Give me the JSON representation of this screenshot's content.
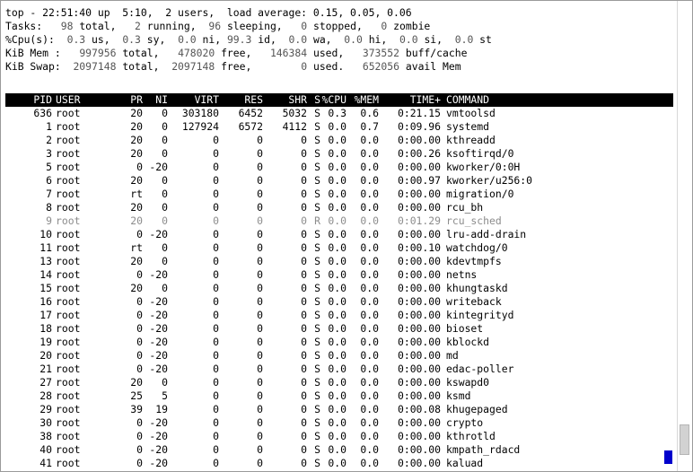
{
  "summary": {
    "line1": "top - 22:51:40 up  5:10,  2 users,  load average: 0.15, 0.05, 0.06",
    "tasks": {
      "label": "Tasks:",
      "total": "98",
      "total_label": "total,",
      "running": "2",
      "running_label": "running,",
      "sleeping": "96",
      "sleeping_label": "sleeping,",
      "stopped": "0",
      "stopped_label": "stopped,",
      "zombie": "0",
      "zombie_label": "zombie"
    },
    "cpu": {
      "label": "%Cpu(s):",
      "us": "0.3",
      "us_label": "us,",
      "sy": "0.3",
      "sy_label": "sy,",
      "ni": "0.0",
      "ni_label": "ni,",
      "id": "99.3",
      "id_label": "id,",
      "wa": "0.0",
      "wa_label": "wa,",
      "hi": "0.0",
      "hi_label": "hi,",
      "si": "0.0",
      "si_label": "si,",
      "st": "0.0",
      "st_label": "st"
    },
    "mem": {
      "label": "KiB Mem :",
      "total": "997956",
      "total_label": "total,",
      "free": "478020",
      "free_label": "free,",
      "used": "146384",
      "used_label": "used,",
      "buff": "373552",
      "buff_label": "buff/cache"
    },
    "swap": {
      "label": "KiB Swap:",
      "total": "2097148",
      "total_label": "total,",
      "free": "2097148",
      "free_label": "free,",
      "used": "0",
      "used_label": "used.",
      "avail": "652056",
      "avail_label": "avail Mem"
    }
  },
  "columns": [
    "PID",
    "USER",
    "PR",
    "NI",
    "VIRT",
    "RES",
    "SHR",
    "S",
    "%CPU",
    "%MEM",
    "TIME+",
    "COMMAND"
  ],
  "processes": [
    [
      "636",
      "root",
      "20",
      "0",
      "303180",
      "6452",
      "5032",
      "S",
      "0.3",
      "0.6",
      "0:21.15",
      "vmtoolsd"
    ],
    [
      "1",
      "root",
      "20",
      "0",
      "127924",
      "6572",
      "4112",
      "S",
      "0.0",
      "0.7",
      "0:09.96",
      "systemd"
    ],
    [
      "2",
      "root",
      "20",
      "0",
      "0",
      "0",
      "0",
      "S",
      "0.0",
      "0.0",
      "0:00.00",
      "kthreadd"
    ],
    [
      "3",
      "root",
      "20",
      "0",
      "0",
      "0",
      "0",
      "S",
      "0.0",
      "0.0",
      "0:00.26",
      "ksoftirqd/0"
    ],
    [
      "5",
      "root",
      "0",
      "-20",
      "0",
      "0",
      "0",
      "S",
      "0.0",
      "0.0",
      "0:00.00",
      "kworker/0:0H"
    ],
    [
      "6",
      "root",
      "20",
      "0",
      "0",
      "0",
      "0",
      "S",
      "0.0",
      "0.0",
      "0:00.97",
      "kworker/u256:0"
    ],
    [
      "7",
      "root",
      "rt",
      "0",
      "0",
      "0",
      "0",
      "S",
      "0.0",
      "0.0",
      "0:00.00",
      "migration/0"
    ],
    [
      "8",
      "root",
      "20",
      "0",
      "0",
      "0",
      "0",
      "S",
      "0.0",
      "0.0",
      "0:00.00",
      "rcu_bh"
    ],
    [
      "9",
      "root",
      "20",
      "0",
      "0",
      "0",
      "0",
      "R",
      "0.0",
      "0.0",
      "0:01.29",
      "rcu_sched"
    ],
    [
      "10",
      "root",
      "0",
      "-20",
      "0",
      "0",
      "0",
      "S",
      "0.0",
      "0.0",
      "0:00.00",
      "lru-add-drain"
    ],
    [
      "11",
      "root",
      "rt",
      "0",
      "0",
      "0",
      "0",
      "S",
      "0.0",
      "0.0",
      "0:00.10",
      "watchdog/0"
    ],
    [
      "13",
      "root",
      "20",
      "0",
      "0",
      "0",
      "0",
      "S",
      "0.0",
      "0.0",
      "0:00.00",
      "kdevtmpfs"
    ],
    [
      "14",
      "root",
      "0",
      "-20",
      "0",
      "0",
      "0",
      "S",
      "0.0",
      "0.0",
      "0:00.00",
      "netns"
    ],
    [
      "15",
      "root",
      "20",
      "0",
      "0",
      "0",
      "0",
      "S",
      "0.0",
      "0.0",
      "0:00.00",
      "khungtaskd"
    ],
    [
      "16",
      "root",
      "0",
      "-20",
      "0",
      "0",
      "0",
      "S",
      "0.0",
      "0.0",
      "0:00.00",
      "writeback"
    ],
    [
      "17",
      "root",
      "0",
      "-20",
      "0",
      "0",
      "0",
      "S",
      "0.0",
      "0.0",
      "0:00.00",
      "kintegrityd"
    ],
    [
      "18",
      "root",
      "0",
      "-20",
      "0",
      "0",
      "0",
      "S",
      "0.0",
      "0.0",
      "0:00.00",
      "bioset"
    ],
    [
      "19",
      "root",
      "0",
      "-20",
      "0",
      "0",
      "0",
      "S",
      "0.0",
      "0.0",
      "0:00.00",
      "kblockd"
    ],
    [
      "20",
      "root",
      "0",
      "-20",
      "0",
      "0",
      "0",
      "S",
      "0.0",
      "0.0",
      "0:00.00",
      "md"
    ],
    [
      "21",
      "root",
      "0",
      "-20",
      "0",
      "0",
      "0",
      "S",
      "0.0",
      "0.0",
      "0:00.00",
      "edac-poller"
    ],
    [
      "27",
      "root",
      "20",
      "0",
      "0",
      "0",
      "0",
      "S",
      "0.0",
      "0.0",
      "0:00.00",
      "kswapd0"
    ],
    [
      "28",
      "root",
      "25",
      "5",
      "0",
      "0",
      "0",
      "S",
      "0.0",
      "0.0",
      "0:00.00",
      "ksmd"
    ],
    [
      "29",
      "root",
      "39",
      "19",
      "0",
      "0",
      "0",
      "S",
      "0.0",
      "0.0",
      "0:00.08",
      "khugepaged"
    ],
    [
      "30",
      "root",
      "0",
      "-20",
      "0",
      "0",
      "0",
      "S",
      "0.0",
      "0.0",
      "0:00.00",
      "crypto"
    ],
    [
      "38",
      "root",
      "0",
      "-20",
      "0",
      "0",
      "0",
      "S",
      "0.0",
      "0.0",
      "0:00.00",
      "kthrotld"
    ],
    [
      "40",
      "root",
      "0",
      "-20",
      "0",
      "0",
      "0",
      "S",
      "0.0",
      "0.0",
      "0:00.00",
      "kmpath_rdacd"
    ],
    [
      "41",
      "root",
      "0",
      "-20",
      "0",
      "0",
      "0",
      "S",
      "0.0",
      "0.0",
      "0:00.00",
      "kaluad"
    ]
  ],
  "dim_rows": [
    "9"
  ],
  "colors": {
    "background": "#ffffff",
    "text": "#000000",
    "header_bg": "#000000",
    "header_text": "#ffffff",
    "dim_text": "#8c8c8c",
    "cursor": "#0000cc"
  }
}
